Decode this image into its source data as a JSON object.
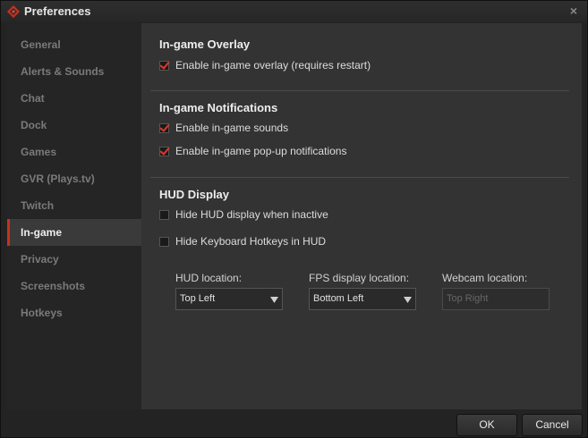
{
  "window": {
    "title": "Preferences",
    "close_glyph": "×",
    "logo_icon": "raptr-logo-icon",
    "accent": "#c8301e"
  },
  "sidebar": {
    "items": [
      {
        "label": "General"
      },
      {
        "label": "Alerts & Sounds"
      },
      {
        "label": "Chat"
      },
      {
        "label": "Dock"
      },
      {
        "label": "Games"
      },
      {
        "label": "GVR (Plays.tv)"
      },
      {
        "label": "Twitch"
      },
      {
        "label": "In-game",
        "active": true
      },
      {
        "label": "Privacy"
      },
      {
        "label": "Screenshots"
      },
      {
        "label": "Hotkeys"
      }
    ]
  },
  "overlay": {
    "title": "In-game Overlay",
    "enable_label": "Enable in-game overlay (requires restart)",
    "enable_checked": true
  },
  "notifications": {
    "title": "In-game Notifications",
    "sounds_label": "Enable in-game sounds",
    "sounds_checked": true,
    "popups_label": "Enable in-game pop-up notifications",
    "popups_checked": true
  },
  "hud": {
    "title": "HUD Display",
    "hide_inactive_label": "Hide HUD display when inactive",
    "hide_inactive_checked": false,
    "hide_hotkeys_label": "Hide Keyboard Hotkeys in HUD",
    "hide_hotkeys_checked": false,
    "location_label": "HUD location:",
    "location_value": "Top Left",
    "fps_label": "FPS display location:",
    "fps_value": "Bottom Left",
    "webcam_label": "Webcam location:",
    "webcam_value": "Top Right"
  },
  "footer": {
    "ok_label": "OK",
    "cancel_label": "Cancel"
  }
}
